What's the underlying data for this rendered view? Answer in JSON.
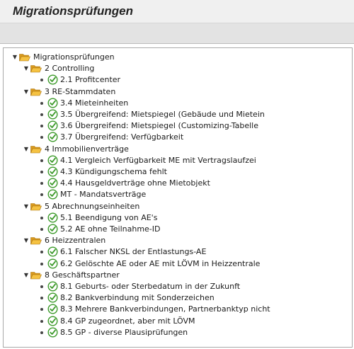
{
  "app": {
    "title": "Migrationsprüfungen"
  },
  "tree": {
    "root": "Migrationsprüfungen",
    "groups": [
      {
        "label": "2 Controlling",
        "items": [
          "2.1 Profitcenter"
        ]
      },
      {
        "label": "3 RE-Stammdaten",
        "items": [
          "3.4 Mieteinheiten",
          "3.5 Übergreifend: Mietspiegel (Gebäude und Mietein",
          "3.6 Übergreifend: Mietspiegel (Customizing-Tabelle",
          "3.7 Übergreifend: Verfügbarkeit"
        ]
      },
      {
        "label": "4 Immobilienverträge",
        "items": [
          "4.1 Vergleich Verfügbarkeit ME mit Vertragslaufzei",
          "4.3 Kündigungschema fehlt",
          "4.4 Hausgeldverträge ohne Mietobjekt",
          "MT - Mandatsverträge"
        ]
      },
      {
        "label": "5 Abrechnungseinheiten",
        "items": [
          "5.1 Beendigung von AE's",
          "5.2 AE ohne Teilnahme-ID"
        ]
      },
      {
        "label": "6 Heizzentralen",
        "items": [
          "6.1 Falscher NKSL der Entlastungs-AE",
          "6.2 Gelöschte AE oder AE mit LÖVM in Heizzentrale"
        ]
      },
      {
        "label": "8 Geschäftspartner",
        "items": [
          "8.1 Geburts- oder Sterbedatum in der Zukunft",
          "8.2 Bankverbindung mit Sonderzeichen",
          "8.3 Mehrere Bankverbindungen, Partnerbanktyp nicht",
          "8.4 GP zugeordnet, aber mit LÖVM",
          "8.5 GP - diverse Plausiprüfungen"
        ]
      }
    ]
  },
  "icons": {
    "folder": "folder-open-icon",
    "item": "check-execute-icon",
    "toggle": "triangle-down-icon"
  },
  "colors": {
    "folder_fill": "#f5c242",
    "folder_dark": "#d99a1e",
    "check_green": "#3c9a2a",
    "title_bar": "#f0f0f0",
    "toolbar": "#e3e3e3"
  }
}
